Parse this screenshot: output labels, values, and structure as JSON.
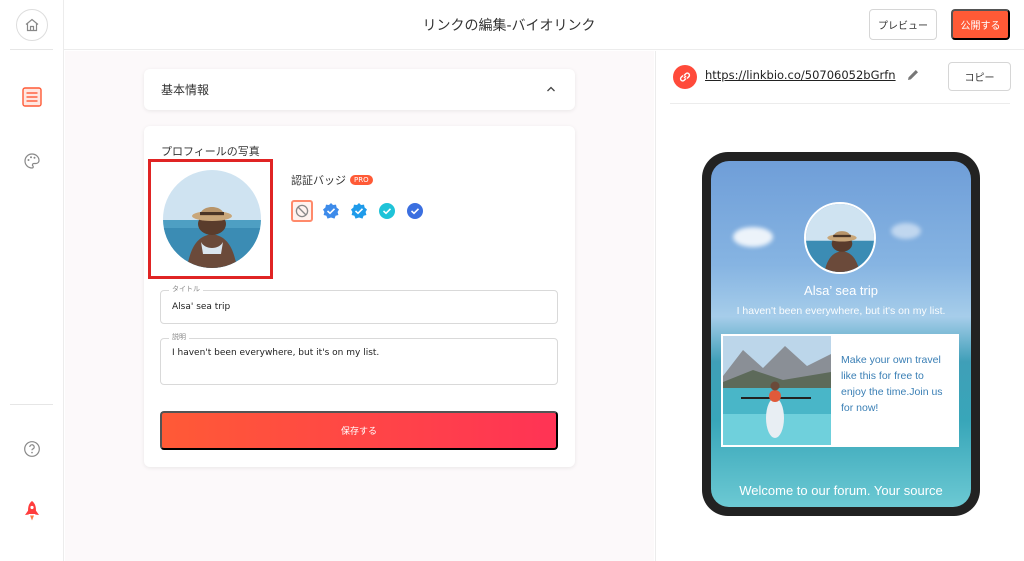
{
  "header": {
    "title": "リンクの編集-バイオリンク",
    "preview_label": "プレビュー",
    "publish_label": "公開する"
  },
  "sidebar": {
    "items": [
      {
        "icon": "home-icon"
      },
      {
        "icon": "edit-page-icon",
        "active": true
      },
      {
        "icon": "palette-icon"
      },
      {
        "icon": "help-icon"
      },
      {
        "icon": "rocket-icon"
      }
    ]
  },
  "basic_info": {
    "title": "基本情報"
  },
  "profile": {
    "photo_label": "プロフィールの写真",
    "badge_label": "認証バッジ",
    "pro_tag": "PRO",
    "badges": [
      "none-badge-icon",
      "verified-badge-blue-icon",
      "verified-badge-azure-icon",
      "verified-badge-teal-icon",
      "verified-badge-royal-icon"
    ],
    "title_caption": "タイトル",
    "title_value": "Alsa' sea trip",
    "desc_caption": "説明",
    "desc_value": "I haven't been everywhere, but it's on my list.",
    "save_label": "保存する"
  },
  "link": {
    "url": "https://linkbio.co/50706052bGrfn",
    "copy_label": "コピー"
  },
  "preview": {
    "name": "Alsa’ sea trip",
    "description": "I haven't been everywhere, but it's on my list.",
    "card_text": "Make your own travel like this for free to enjoy the time.Join us for now!",
    "footer": "Welcome to our forum. Your source"
  },
  "colors": {
    "accent": "#ff5a36",
    "highlight_border": "#e02424"
  }
}
